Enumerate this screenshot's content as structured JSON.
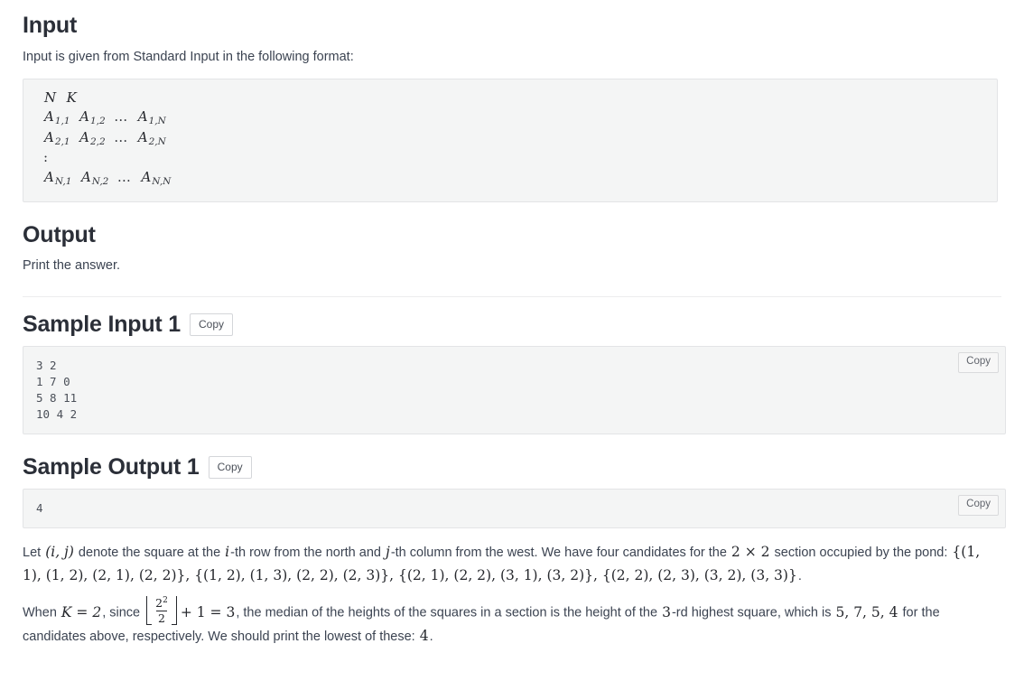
{
  "sections": {
    "input": {
      "heading": "Input",
      "description": "Input is given from Standard Input in the following format:",
      "format_lines": [
        {
          "type": "tokens",
          "tokens": [
            {
              "base": "N"
            },
            {
              "base": "K"
            }
          ]
        },
        {
          "type": "tokens",
          "tokens": [
            {
              "base": "A",
              "sub": "1,1"
            },
            {
              "base": "A",
              "sub": "1,2"
            },
            {
              "dots": "..."
            },
            {
              "base": "A",
              "sub": "1,N"
            }
          ]
        },
        {
          "type": "tokens",
          "tokens": [
            {
              "base": "A",
              "sub": "2,1"
            },
            {
              "base": "A",
              "sub": "2,2"
            },
            {
              "dots": "..."
            },
            {
              "base": "A",
              "sub": "2,N"
            }
          ]
        },
        {
          "type": "vdots",
          "text": ":"
        },
        {
          "type": "tokens",
          "tokens": [
            {
              "base": "A",
              "sub": "N,1"
            },
            {
              "base": "A",
              "sub": "N,2"
            },
            {
              "dots": "..."
            },
            {
              "base": "A",
              "sub": "N,N"
            }
          ]
        }
      ]
    },
    "output": {
      "heading": "Output",
      "description": "Print the answer."
    },
    "sample_input_1": {
      "heading": "Sample Input 1",
      "copy_label": "Copy",
      "corner_copy_label": "Copy",
      "content": "3 2\n1 7 0\n5 8 11\n10 4 2"
    },
    "sample_output_1": {
      "heading": "Sample Output 1",
      "copy_label": "Copy",
      "corner_copy_label": "Copy",
      "content": "4"
    }
  },
  "explanation": {
    "p1": {
      "t1": "Let ",
      "m1": "(i, j)",
      "t2": " denote the square at the ",
      "m2": "i",
      "t3": "-th row from the north and ",
      "m3": "j",
      "t4": "-th column from the west. We have four candidates for the ",
      "m4": "2 × 2",
      "t5": " section occupied by the pond: ",
      "m5": "{(1, 1), (1, 2), (2, 1), (2, 2)}, {(1, 2), (1, 3), (2, 2), (2, 3)}, {(2, 1), (2, 2), (3, 1), (3, 2)}, {(2, 2), (2, 3), (3, 2), (3, 3)}",
      "t6": "."
    },
    "p2": {
      "t1": "When ",
      "m1": "K = 2",
      "t2": ", since ",
      "frac_num_base": "2",
      "frac_num_exp": "2",
      "frac_den": "2",
      "m2": "+ 1 = 3",
      "t3": ", the median of the heights of the squares in a section is the height of the ",
      "m3": "3",
      "t4": "-rd highest square, which is ",
      "m4": "5, 7, 5, 4",
      "t5": " for the candidates above, respectively. We should print the lowest of these: ",
      "m5": "4",
      "t6": "."
    }
  }
}
